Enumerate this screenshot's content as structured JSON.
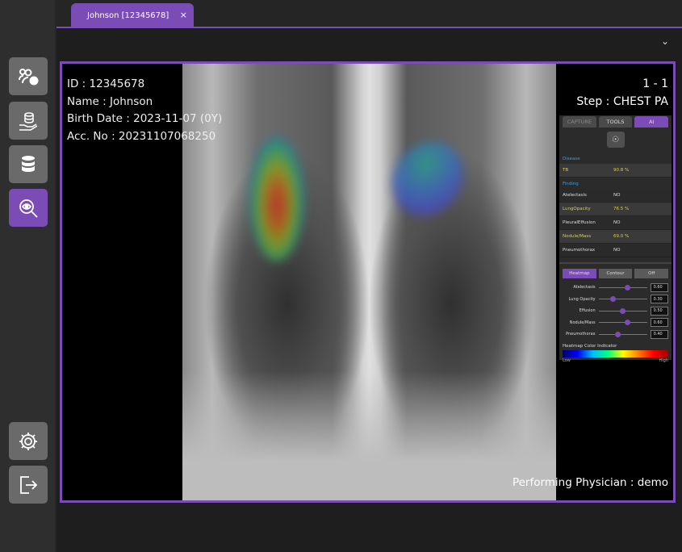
{
  "sidebar": {
    "items": [
      {
        "icon": "add-patient-icon"
      },
      {
        "icon": "hand-database-icon"
      },
      {
        "icon": "database-icon"
      },
      {
        "icon": "ai-view-icon",
        "active": true
      },
      {
        "icon": "gear-icon"
      },
      {
        "icon": "logout-icon"
      }
    ]
  },
  "tab": {
    "label": "Johnson [12345678]",
    "close": "×"
  },
  "header": {
    "chevron": "⌄"
  },
  "patient": {
    "id": "ID : 12345678",
    "name": "Name : Johnson",
    "birth": "Birth Date : 2023-11-07 (0Y)",
    "acc": "Acc. No : 20231107068250"
  },
  "series": {
    "index": "1 - 1",
    "step": "Step : CHEST PA"
  },
  "physician": "Performing Physician : demo",
  "panel": {
    "tabs": [
      "CAPTURE",
      "TOOLS",
      "AI"
    ],
    "disease_title": "Disease",
    "disease": [
      {
        "name": "TB",
        "value": "90.8 %",
        "highlight": true
      }
    ],
    "finding_title": "Finding",
    "findings": [
      {
        "name": "Atelectasis",
        "value": "NO"
      },
      {
        "name": "LungOpacity",
        "value": "76.5 %",
        "highlight": true
      },
      {
        "name": "PleuralEffusion",
        "value": "NO"
      },
      {
        "name": "Nodule/Mass",
        "value": "69.0 %",
        "highlight": true
      },
      {
        "name": "Pneumothorax",
        "value": "NO"
      }
    ],
    "modes": [
      "Heatmap",
      "Contour",
      "Off"
    ],
    "thresholds": [
      {
        "name": "Atelectasis",
        "value": "0.60"
      },
      {
        "name": "Lung Opacity",
        "value": "0.30"
      },
      {
        "name": "Effusion",
        "value": "0.50"
      },
      {
        "name": "Nodule/Mass",
        "value": "0.60"
      },
      {
        "name": "Pneumothorax",
        "value": "0.40"
      }
    ],
    "color_indicator": "Heatmap Color Indicator",
    "low": "Low",
    "high": "High"
  },
  "colors": {
    "accent": "#7b4cb6",
    "highlight": "#d4d43a",
    "section": "#3d9be0"
  }
}
